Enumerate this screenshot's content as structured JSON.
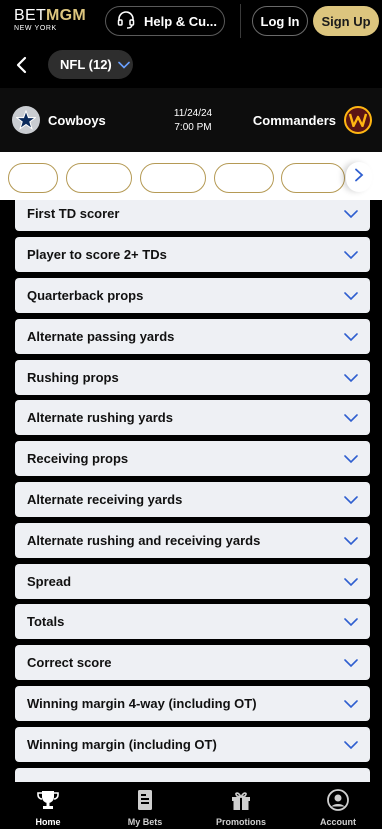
{
  "header": {
    "logo_prefix": "BET",
    "logo_suffix": "MGM",
    "logo_region": "NEW YORK",
    "help_label": "Help & Cu...",
    "login_label": "Log In",
    "signup_label": "Sign Up"
  },
  "subnav": {
    "league_label": "NFL (12)"
  },
  "game": {
    "home_team": "Cowboys",
    "away_team": "Commanders",
    "date": "11/24/24",
    "time": "7:00 PM"
  },
  "markets": [
    {
      "label": "First TD scorer"
    },
    {
      "label": "Player to score 2+ TDs"
    },
    {
      "label": "Quarterback props"
    },
    {
      "label": "Alternate passing yards"
    },
    {
      "label": "Rushing props"
    },
    {
      "label": "Alternate rushing yards"
    },
    {
      "label": "Receiving props"
    },
    {
      "label": "Alternate receiving yards"
    },
    {
      "label": "Alternate rushing and receiving yards"
    },
    {
      "label": "Spread"
    },
    {
      "label": "Totals"
    },
    {
      "label": "Correct score"
    },
    {
      "label": "Winning margin 4-way (including OT)"
    },
    {
      "label": "Winning margin (including OT)"
    }
  ],
  "bottom_nav": {
    "items": [
      {
        "label": "Home",
        "icon": "trophy-icon"
      },
      {
        "label": "My Bets",
        "icon": "bet-slip-icon"
      },
      {
        "label": "Promotions",
        "icon": "gift-icon"
      },
      {
        "label": "Account",
        "icon": "account-icon"
      }
    ]
  },
  "colors": {
    "accent_gold": "#dcc57e",
    "chevron_blue": "#2f5fd0",
    "item_bg": "#eef0f4"
  }
}
